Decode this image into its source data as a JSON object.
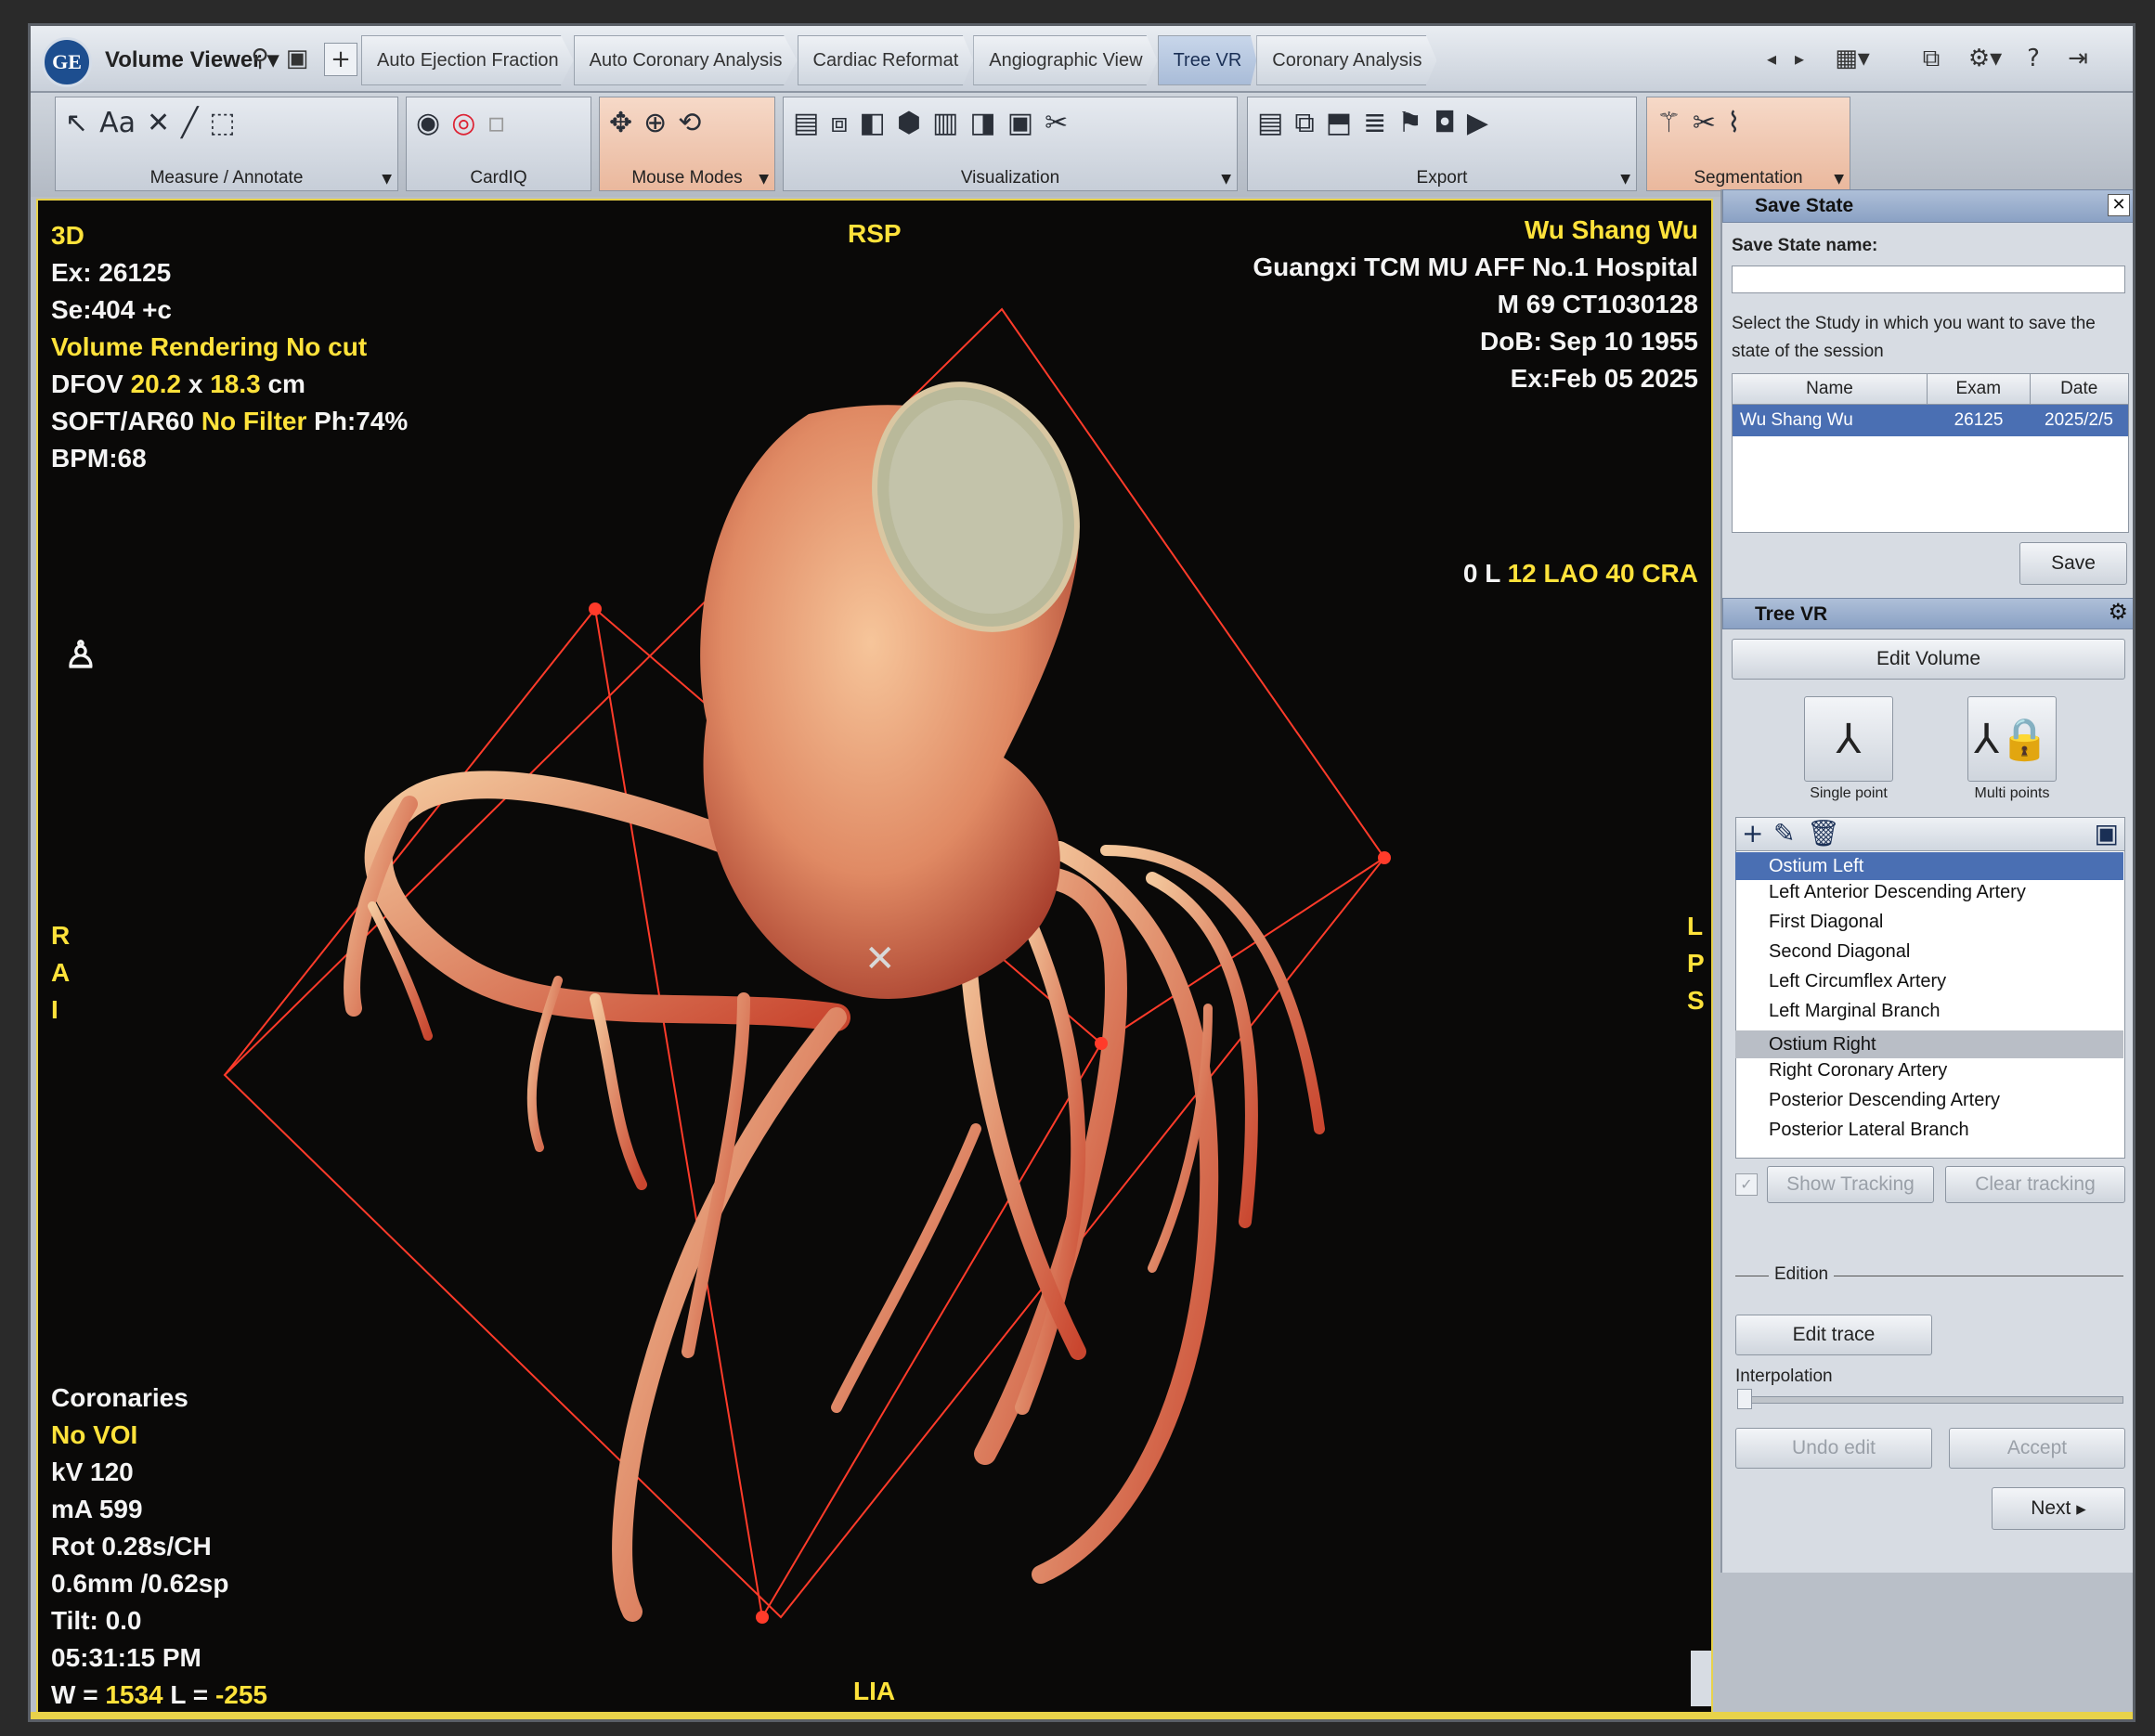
{
  "app": {
    "title": "Volume Viewer"
  },
  "tabs": [
    {
      "label": "Auto Ejection Fraction",
      "active": false
    },
    {
      "label": "Auto Coronary Analysis",
      "active": false
    },
    {
      "label": "Cardiac Reformat",
      "active": false
    },
    {
      "label": "Angiographic View",
      "active": false
    },
    {
      "label": "Tree VR",
      "active": true
    },
    {
      "label": "Coronary Analysis",
      "active": false
    }
  ],
  "toolbar": {
    "groups": [
      {
        "label": "Measure / Annotate"
      },
      {
        "label": "CardIQ"
      },
      {
        "label": "Mouse Modes"
      },
      {
        "label": "Visualization"
      },
      {
        "label": "Export"
      },
      {
        "label": "Segmentation"
      }
    ],
    "measure_text_icon": "Aa"
  },
  "viewport": {
    "top_left": [
      "3D",
      "Ex: 26125",
      "Se:404 +c",
      "Volume Rendering No cut"
    ],
    "dfov": {
      "prefix": "DFOV ",
      "w": "20.2",
      "x": " x ",
      "h": "18.3",
      "unit": " cm"
    },
    "filter": {
      "a": "SOFT/AR60 ",
      "b": "No Filter",
      "c": " Ph:74%"
    },
    "bpm": "BPM:68",
    "orient_top": "RSP",
    "orient_bottom": "LIA",
    "orient_left": [
      "R",
      "A",
      "I"
    ],
    "orient_right": [
      "L",
      "P",
      "S"
    ],
    "patient_name": "Wu Shang Wu",
    "hospital": "Guangxi TCM MU AFF No.1 Hospital",
    "patient_id": "M 69 CT1030128",
    "dob": "DoB: Sep 10 1955",
    "exam_date": "Ex:Feb 05 2025",
    "angle": {
      "a": "0 L ",
      "b": "12 LAO 40 CRA"
    },
    "bottom_left": [
      "Coronaries",
      "No VOI",
      "kV 120",
      "mA 599",
      "Rot 0.28s/CH",
      "0.6mm /0.62sp",
      "Tilt: 0.0",
      "05:31:15 PM"
    ],
    "wl": {
      "w_label": "W = ",
      "w": "1534",
      "l_label": " L = ",
      "l": "-255"
    }
  },
  "save_state": {
    "title": "Save State",
    "name_label": "Save State name:",
    "name_value": "",
    "instruction": "Select the Study in which you want to save the state of the session",
    "columns": [
      "Name",
      "Exam",
      "Date"
    ],
    "row": {
      "name": "Wu Shang Wu",
      "exam": "26125",
      "date": "2025/2/5"
    },
    "save_button": "Save"
  },
  "tree_vr": {
    "title": "Tree VR",
    "edit_volume": "Edit Volume",
    "single_point": "Single point",
    "multi_points": "Multi points",
    "left_header": "Ostium Left",
    "left_items": [
      "Left Anterior Descending Artery",
      "First Diagonal",
      "Second Diagonal",
      "Left Circumflex Artery",
      "Left Marginal Branch"
    ],
    "right_header": "Ostium Right",
    "right_items": [
      "Right Coronary Artery",
      "Posterior Descending Artery",
      "Posterior Lateral Branch"
    ],
    "show_tracking": "Show Tracking",
    "clear_tracking": "Clear tracking",
    "edition": "Edition",
    "edit_trace": "Edit trace",
    "interpolation": "Interpolation",
    "undo_edit": "Undo edit",
    "accept": "Accept",
    "next": "Next"
  },
  "colors": {
    "overlay_yellow": "#ffe23a",
    "vessel": "#e8735a",
    "box_line": "#ff3b2a",
    "selection": "#4a6fb3"
  }
}
